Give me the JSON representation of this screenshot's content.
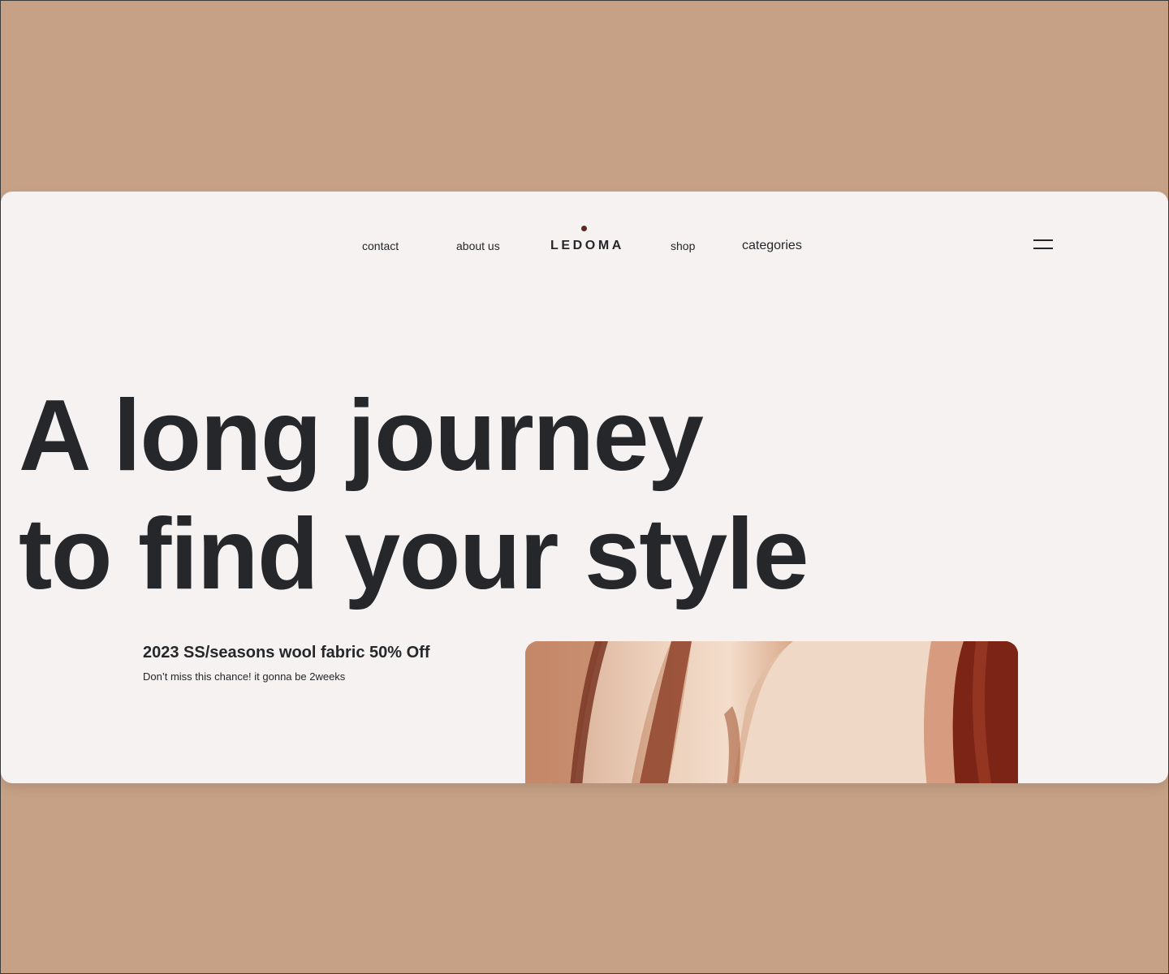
{
  "nav": {
    "contact": "contact",
    "about": "about us",
    "logo": "LEDOMA",
    "shop": "shop",
    "categories": "categories"
  },
  "hero": {
    "line1": "A long journey",
    "line2": "to find your style"
  },
  "promo": {
    "title": "2023 SS/seasons wool fabric 50% Off",
    "subtitle": "Don’t miss this chance! it gonna be 2weeks"
  },
  "icons": {
    "menu": "hamburger-menu-icon",
    "logo_dot": "dot-icon"
  },
  "colors": {
    "background": "#c6a186",
    "card": "#f5f2f1",
    "text": "#25272b",
    "accent_dot": "#5a2a22"
  }
}
